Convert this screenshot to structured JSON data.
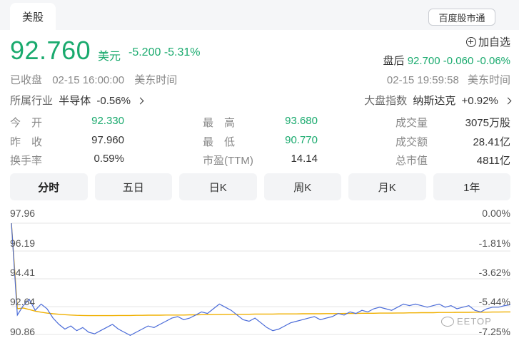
{
  "header": {
    "tab_label": "美股",
    "baidu_label": "百度股市通"
  },
  "quote": {
    "price": "92.760",
    "currency": "美元",
    "change": "-5.200",
    "change_pct": "-5.31%",
    "watch_label": "加自选",
    "after_hours_label": "盘后",
    "after_hours_price": "92.700",
    "after_hours_change": "-0.060",
    "after_hours_pct": "-0.06%"
  },
  "status": {
    "label": "已收盘",
    "date": "02-15 16:00:00",
    "tz": "美东时间",
    "right_date": "02-15 19:59:58",
    "right_tz": "美东时间"
  },
  "industry": {
    "label": "所属行业",
    "name": "半导体",
    "pct": "-0.56%"
  },
  "market_index": {
    "label": "大盘指数",
    "name": "纳斯达克",
    "pct": "+0.92%"
  },
  "stats": [
    {
      "label": "今　开",
      "value": "92.330",
      "color": "green"
    },
    {
      "label": "最　高",
      "value": "93.680",
      "color": "green"
    },
    {
      "label": "成交量",
      "value": "3075万股",
      "color": "normal"
    },
    {
      "label": "昨　收",
      "value": "97.960",
      "color": "normal"
    },
    {
      "label": "最　低",
      "value": "90.770",
      "color": "green"
    },
    {
      "label": "成交额",
      "value": "28.41亿",
      "color": "normal"
    },
    {
      "label": "换手率",
      "value": "0.59%",
      "color": "normal"
    },
    {
      "label": "市盈(TTM)",
      "value": "14.14",
      "color": "normal"
    },
    {
      "label": "总市值",
      "value": "4811亿",
      "color": "normal"
    }
  ],
  "tabs": [
    {
      "label": "分时",
      "active": true
    },
    {
      "label": "五日",
      "active": false
    },
    {
      "label": "日K",
      "active": false
    },
    {
      "label": "周K",
      "active": false
    },
    {
      "label": "月K",
      "active": false
    },
    {
      "label": "1年",
      "active": false
    }
  ],
  "colors": {
    "down": "#1aaa6e",
    "price_line": "#4a6bd8",
    "avg_line": "#f0b000"
  },
  "chart_data": {
    "type": "line",
    "y_left_ticks": [
      "97.96",
      "96.19",
      "94.41",
      "92.64",
      "90.86"
    ],
    "y_right_ticks": [
      "0.00%",
      "-1.81%",
      "-3.62%",
      "-5.44%",
      "-7.25%"
    ],
    "ylim": [
      90.86,
      97.96
    ],
    "grid": true,
    "series": [
      {
        "role": "price",
        "values": [
          97.96,
          92.1,
          92.7,
          93.1,
          92.4,
          92.8,
          92.5,
          91.9,
          91.5,
          91.2,
          91.4,
          91.1,
          91.3,
          91.0,
          90.9,
          91.1,
          91.3,
          91.5,
          91.2,
          91.0,
          90.8,
          91.0,
          91.2,
          91.4,
          91.3,
          91.5,
          91.7,
          91.9,
          92.0,
          91.8,
          91.9,
          92.1,
          92.3,
          92.2,
          92.5,
          92.8,
          92.6,
          92.4,
          92.1,
          91.8,
          91.7,
          91.9,
          91.6,
          91.3,
          91.1,
          91.2,
          91.4,
          91.6,
          91.7,
          91.8,
          91.9,
          92.0,
          91.8,
          91.9,
          92.0,
          92.2,
          92.1,
          92.3,
          92.2,
          92.4,
          92.3,
          92.5,
          92.6,
          92.5,
          92.4,
          92.6,
          92.8,
          92.7,
          92.8,
          92.7,
          92.6,
          92.7,
          92.8,
          92.6,
          92.7,
          92.5,
          92.6,
          92.7,
          92.4,
          92.3,
          92.5,
          92.6,
          92.6,
          92.7,
          92.76
        ]
      },
      {
        "role": "average",
        "values": [
          97.96,
          92.5,
          92.55,
          92.45,
          92.35,
          92.28,
          92.22,
          92.18,
          92.15,
          92.12,
          92.1,
          92.08,
          92.07,
          92.06,
          92.06,
          92.06,
          92.06,
          92.06,
          92.07,
          92.07,
          92.07,
          92.08,
          92.08,
          92.09,
          92.09,
          92.09,
          92.1,
          92.1,
          92.1,
          92.1,
          92.11,
          92.11,
          92.12,
          92.12,
          92.13,
          92.13,
          92.14,
          92.14,
          92.15,
          92.15,
          92.15,
          92.16,
          92.16,
          92.16,
          92.16,
          92.17,
          92.17,
          92.17,
          92.17,
          92.18,
          92.18,
          92.18,
          92.18,
          92.19,
          92.19,
          92.19,
          92.2,
          92.2,
          92.2,
          92.21,
          92.21,
          92.21,
          92.22,
          92.22,
          92.22,
          92.23,
          92.23,
          92.24,
          92.24,
          92.25,
          92.25,
          92.25,
          92.26,
          92.26,
          92.26,
          92.27,
          92.27,
          92.27,
          92.28,
          92.28,
          92.28,
          92.29,
          92.29,
          92.3,
          92.3
        ]
      }
    ]
  },
  "watermark": "EETOP"
}
